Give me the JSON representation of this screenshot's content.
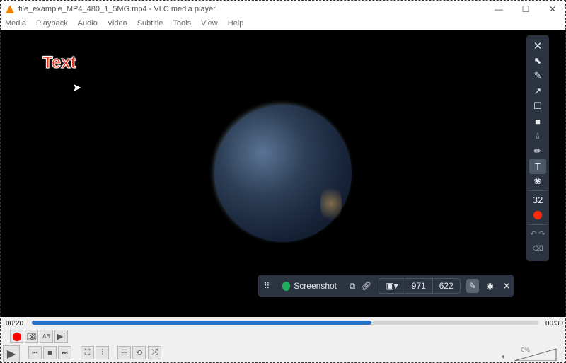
{
  "window": {
    "title": "file_example_MP4_480_1_5MG.mp4 - VLC media player",
    "minimize": "—",
    "maximize": "☐",
    "close": "✕"
  },
  "menu": [
    "Media",
    "Playback",
    "Audio",
    "Video",
    "Subtitle",
    "Tools",
    "View",
    "Help"
  ],
  "video": {
    "overlay_text": "Text"
  },
  "annotation_toolbar": {
    "font_size": "32",
    "color": "#ff2a0a",
    "tools": [
      "close",
      "select",
      "pen",
      "arrow",
      "rectangle",
      "filled-rectangle",
      "blur",
      "highlighter",
      "text",
      "sticker",
      "undo",
      "redo",
      "clear"
    ],
    "selected_tool": "text"
  },
  "capture_bar": {
    "label": "Screenshot",
    "width": "971",
    "height": "622"
  },
  "playback": {
    "elapsed": "00:20",
    "total": "00:30",
    "progress": 0.67,
    "volume": "0%",
    "volume_level": 0
  }
}
